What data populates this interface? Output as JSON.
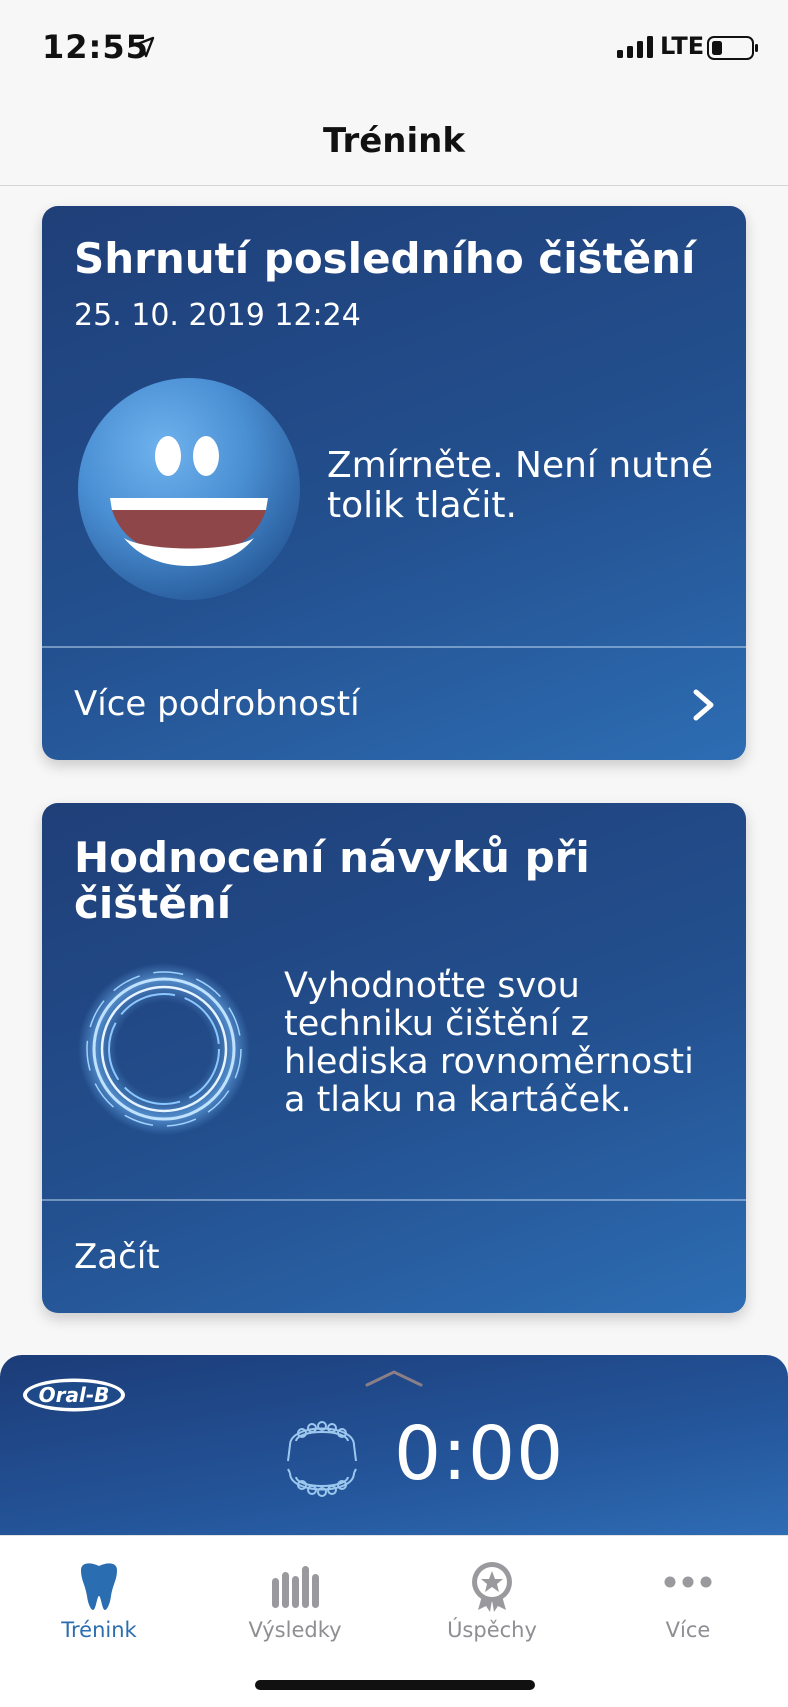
{
  "status_bar": {
    "time": "12:55",
    "network": "LTE"
  },
  "nav": {
    "title": "Trénink"
  },
  "last_brushing_card": {
    "title": "Shrnutí posledního čištění",
    "date": "25. 10. 2019 12:24",
    "message": "Zmírněte. Není nutné tolik tlačit.",
    "action_label": "Více podrobností",
    "mascot_icon": "happy-face-icon"
  },
  "habit_card": {
    "title": "Hodnocení návyků při čištění",
    "message": "Vyhodnoťte svou techniku čištění z hlediska rovnoměrnosti a tlaku na kartáček.",
    "action_label": "Začít",
    "icon": "glowing-ring-icon"
  },
  "brush_panel": {
    "logo": "Oral-B",
    "timer": "0:00"
  },
  "tabs": [
    {
      "label": "Trénink",
      "icon": "tooth-icon",
      "active": true
    },
    {
      "label": "Výsledky",
      "icon": "bars-icon",
      "active": false
    },
    {
      "label": "Úspěchy",
      "icon": "award-icon",
      "active": false
    },
    {
      "label": "Více",
      "icon": "more-dots-icon",
      "active": false
    }
  ],
  "colors": {
    "card_dark": "#1f3f78",
    "card_light": "#2d6db3",
    "tab_active": "#2a6db0",
    "tab_inactive": "#8e8e93"
  }
}
